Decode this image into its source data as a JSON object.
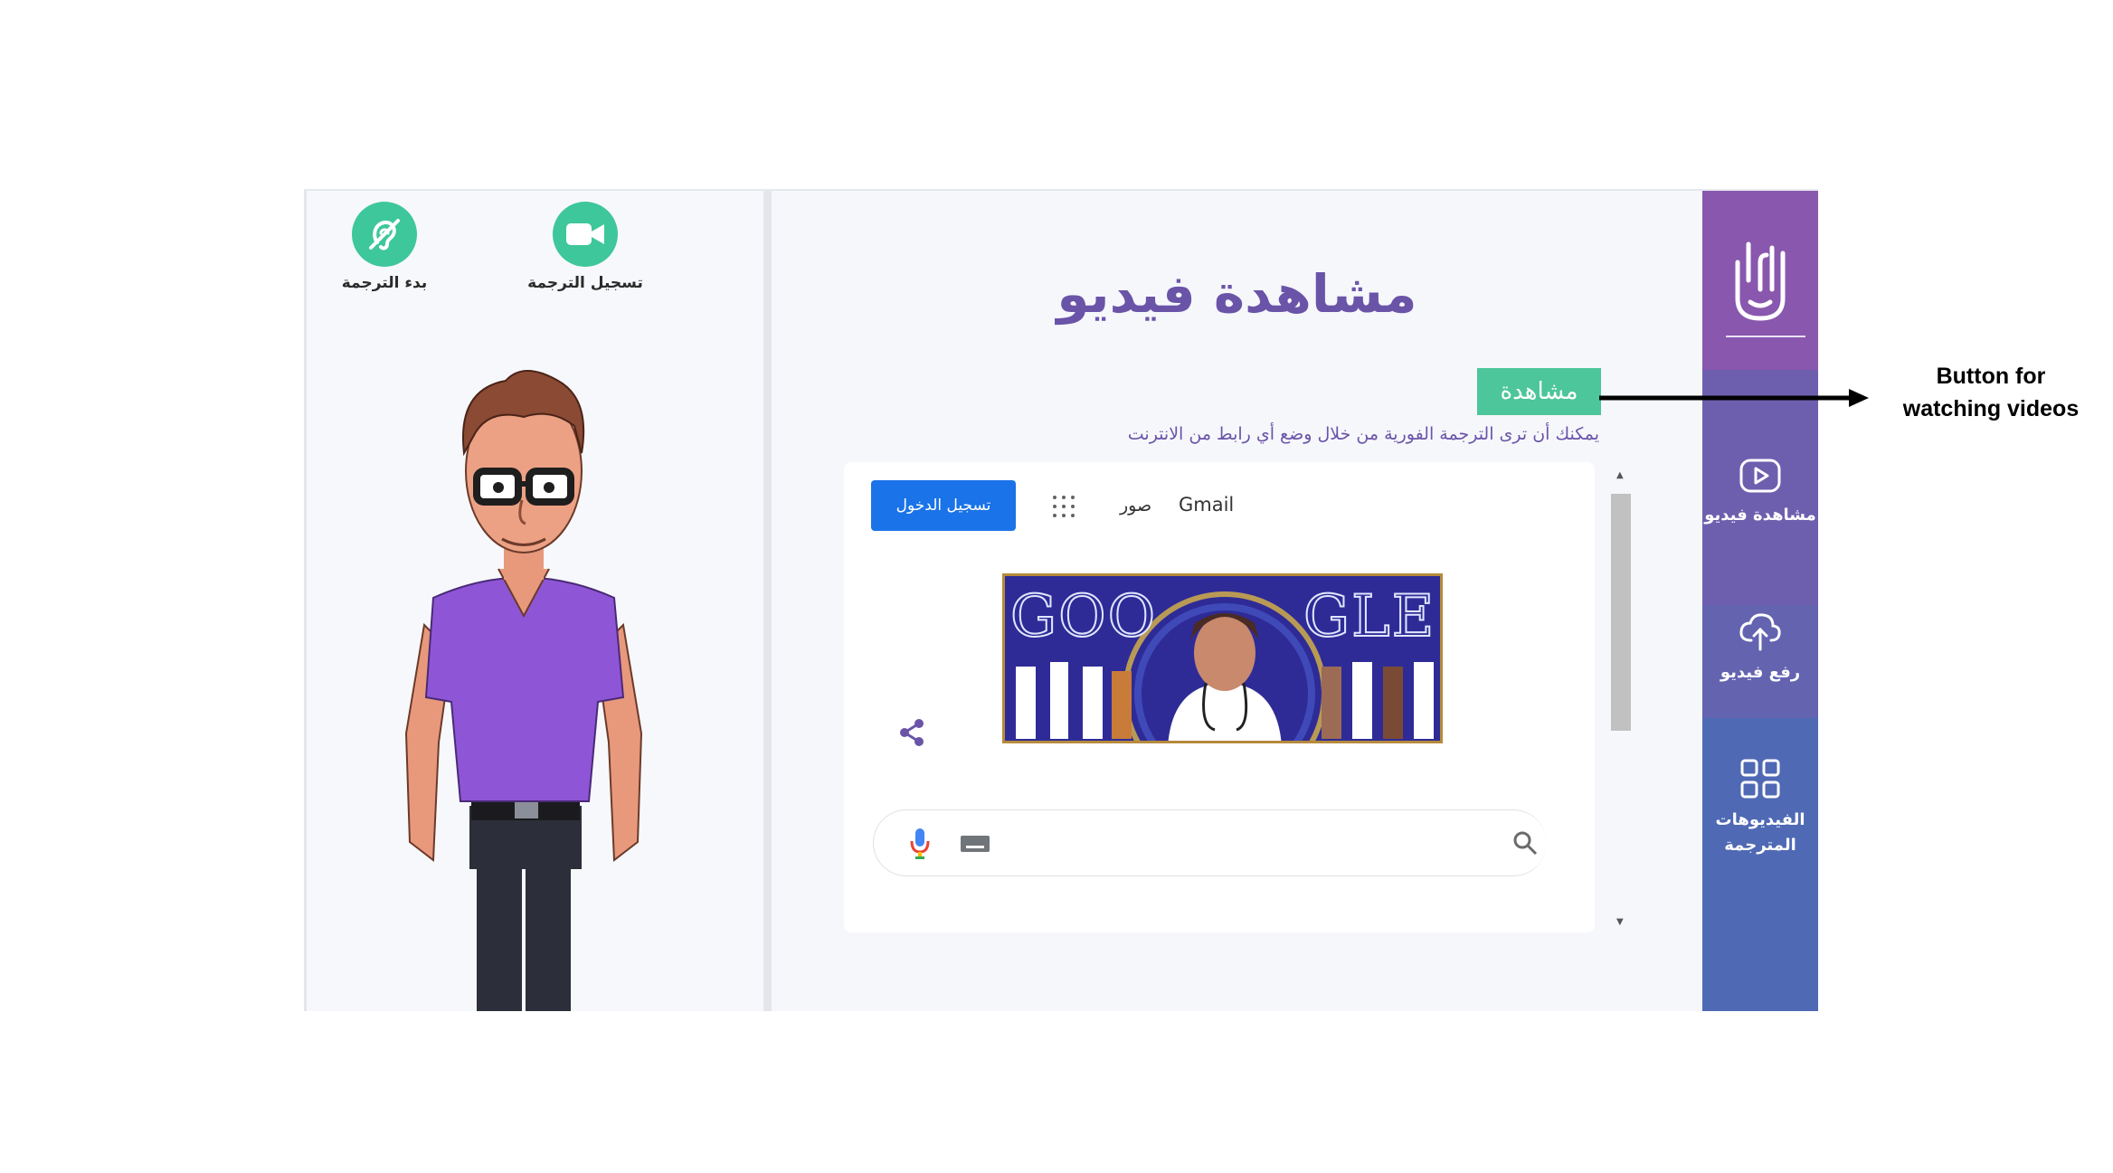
{
  "left_panel": {
    "record_label": "تسجيل الترجمة",
    "start_label": "بدء الترجمة"
  },
  "main": {
    "title": "مشاهدة فيديو",
    "watch_button": "مشاهدة",
    "hint": "يمكنك أن ترى الترجمة الفورية من خلال وضع أي رابط من الانترنت",
    "browser": {
      "signin_label": "تسجيل الدخول",
      "images_link": "صور",
      "gmail_link": "Gmail",
      "doodle_left": "GOO",
      "doodle_right": "GLE"
    }
  },
  "sidebar": {
    "items": [
      {
        "label": "مشاهدة فيديو",
        "icon": "play-icon"
      },
      {
        "label": "رفع فيديو",
        "icon": "cloud-upload-icon"
      },
      {
        "label": "الفيديوهات المترجمة",
        "icon": "grid-icon"
      }
    ]
  },
  "annotation": {
    "line1": "Button for",
    "line2": "watching videos"
  },
  "colors": {
    "accent_green": "#3ec79a",
    "title_purple": "#6a54a8",
    "sidebar_top": "#8957ae",
    "sidebar_bottom": "#4a6bb5",
    "google_blue": "#1a73e8"
  }
}
